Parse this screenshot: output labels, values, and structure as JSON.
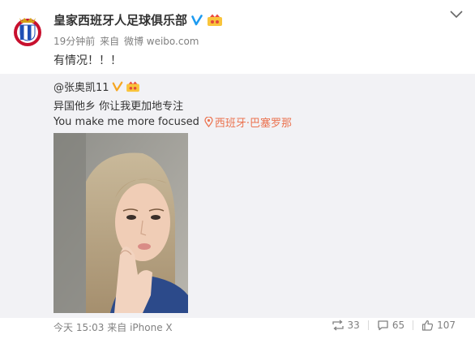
{
  "header": {
    "account_name": "皇家西班牙人足球俱乐部",
    "avatar_icon": "espanyol-crest-icon",
    "verified_icon": "verified-v-icon",
    "member_icon": "weibo-member-icon"
  },
  "meta": {
    "time": "19分钟前",
    "source_prefix": "来自",
    "source": "微博 weibo.com"
  },
  "post": {
    "text": "有情况！！！"
  },
  "repost": {
    "user": "@张奥凯11",
    "line1": "异国他乡 你让我更加地专注",
    "line2": "You make me more focused",
    "location": "西班牙·巴塞罗那",
    "location_icon": "location-pin-icon",
    "photo_icon": "selfie-photo"
  },
  "footer": {
    "time": "今天 15:03",
    "source_prefix": "来自",
    "source": "iPhone X",
    "repost_count": "33",
    "comment_count": "65",
    "like_count": "107"
  },
  "colors": {
    "accent_orange": "#eb7350",
    "verified_blue": "#1d9bf0",
    "repost_bg": "#f2f2f5",
    "muted_text": "#808080"
  }
}
